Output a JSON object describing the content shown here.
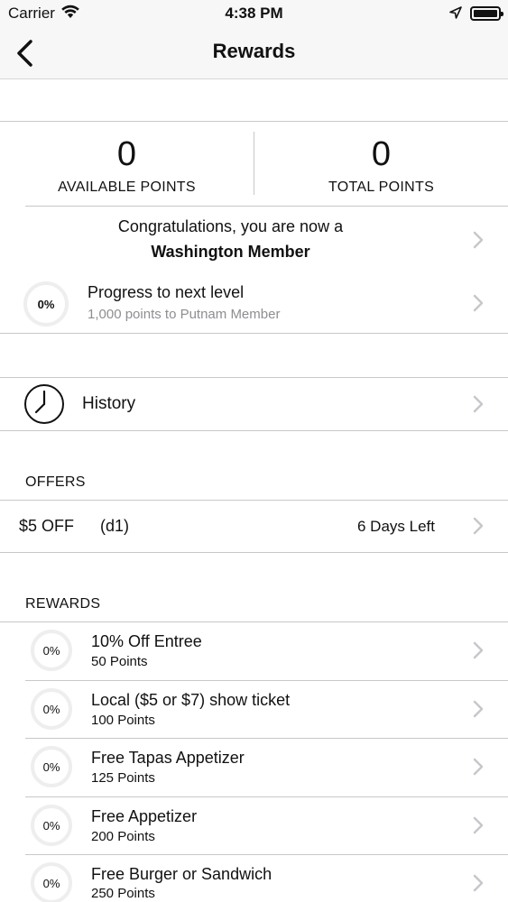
{
  "status_bar": {
    "carrier": "Carrier",
    "time": "4:38 PM"
  },
  "nav": {
    "title": "Rewards",
    "back_icon": "chevron-left-icon"
  },
  "points": {
    "available_value": "0",
    "available_label": "AVAILABLE POINTS",
    "total_value": "0",
    "total_label": "TOTAL POINTS"
  },
  "membership": {
    "line1": "Congratulations, you are now a",
    "line2": "Washington Member"
  },
  "progress": {
    "percent_label": "0%",
    "percent": 0,
    "title": "Progress to next level",
    "subtitle": "1,000 points to Putnam Member"
  },
  "history": {
    "label": "History",
    "icon": "clock-icon"
  },
  "offers": {
    "header": "OFFERS",
    "items": [
      {
        "title": "$5 OFF",
        "code": "(d1)",
        "days_left": "6 Days Left"
      }
    ]
  },
  "rewards": {
    "header": "REWARDS",
    "items": [
      {
        "percent_label": "0%",
        "title": "10% Off Entree",
        "points": "50 Points"
      },
      {
        "percent_label": "0%",
        "title": "Local ($5 or $7) show ticket",
        "points": "100 Points"
      },
      {
        "percent_label": "0%",
        "title": "Free Tapas Appetizer",
        "points": "125 Points"
      },
      {
        "percent_label": "0%",
        "title": "Free Appetizer",
        "points": "200 Points"
      },
      {
        "percent_label": "0%",
        "title": "Free Burger or Sandwich",
        "points": "250 Points"
      }
    ]
  },
  "colors": {
    "divider": "#c8c8c8",
    "chevron": "#c7c7cc",
    "subtitle": "#8e8e93",
    "ring": "#eeeeee"
  }
}
